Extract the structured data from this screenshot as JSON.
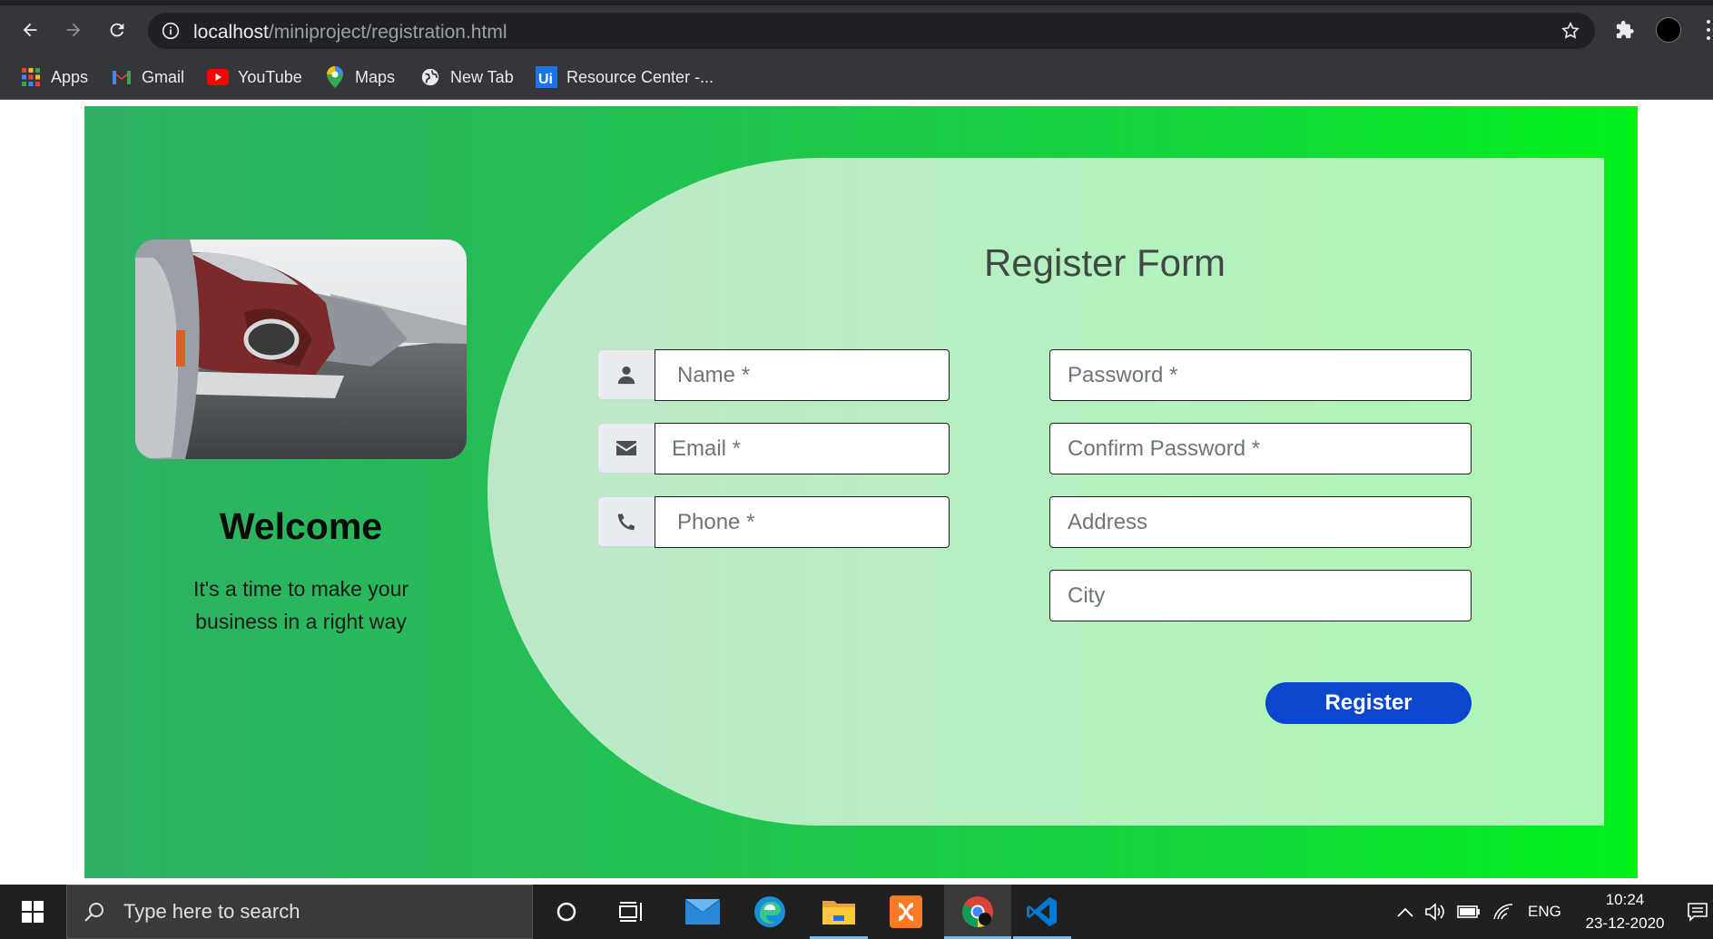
{
  "browser": {
    "url_host": "localhost",
    "url_path": "/miniproject/registration.html",
    "bookmarks": [
      {
        "label": "Apps",
        "icon": "apps-grid-icon"
      },
      {
        "label": "Gmail",
        "icon": "gmail-icon"
      },
      {
        "label": "YouTube",
        "icon": "youtube-icon"
      },
      {
        "label": "Maps",
        "icon": "maps-icon"
      },
      {
        "label": "New Tab",
        "icon": "globe-icon"
      },
      {
        "label": "Resource Center -...",
        "icon": "ui-icon"
      }
    ]
  },
  "welcome": {
    "title": "Welcome",
    "tagline": "It's a time to make your business in a right way"
  },
  "form": {
    "title": "Register Form",
    "name_placeholder": "Name *",
    "email_placeholder": "Email *",
    "phone_placeholder": "Phone *",
    "password_placeholder": "Password *",
    "confirm_password_placeholder": "Confirm Password *",
    "address_placeholder": "Address",
    "city_placeholder": "City",
    "register_label": "Register"
  },
  "taskbar": {
    "search_placeholder": "Type here to search",
    "language": "ENG",
    "time": "10:24",
    "date": "23-12-2020"
  },
  "colors": {
    "accent_button": "#0a47cc",
    "gradient_start": "#2fb066",
    "gradient_end": "#00f01a"
  }
}
